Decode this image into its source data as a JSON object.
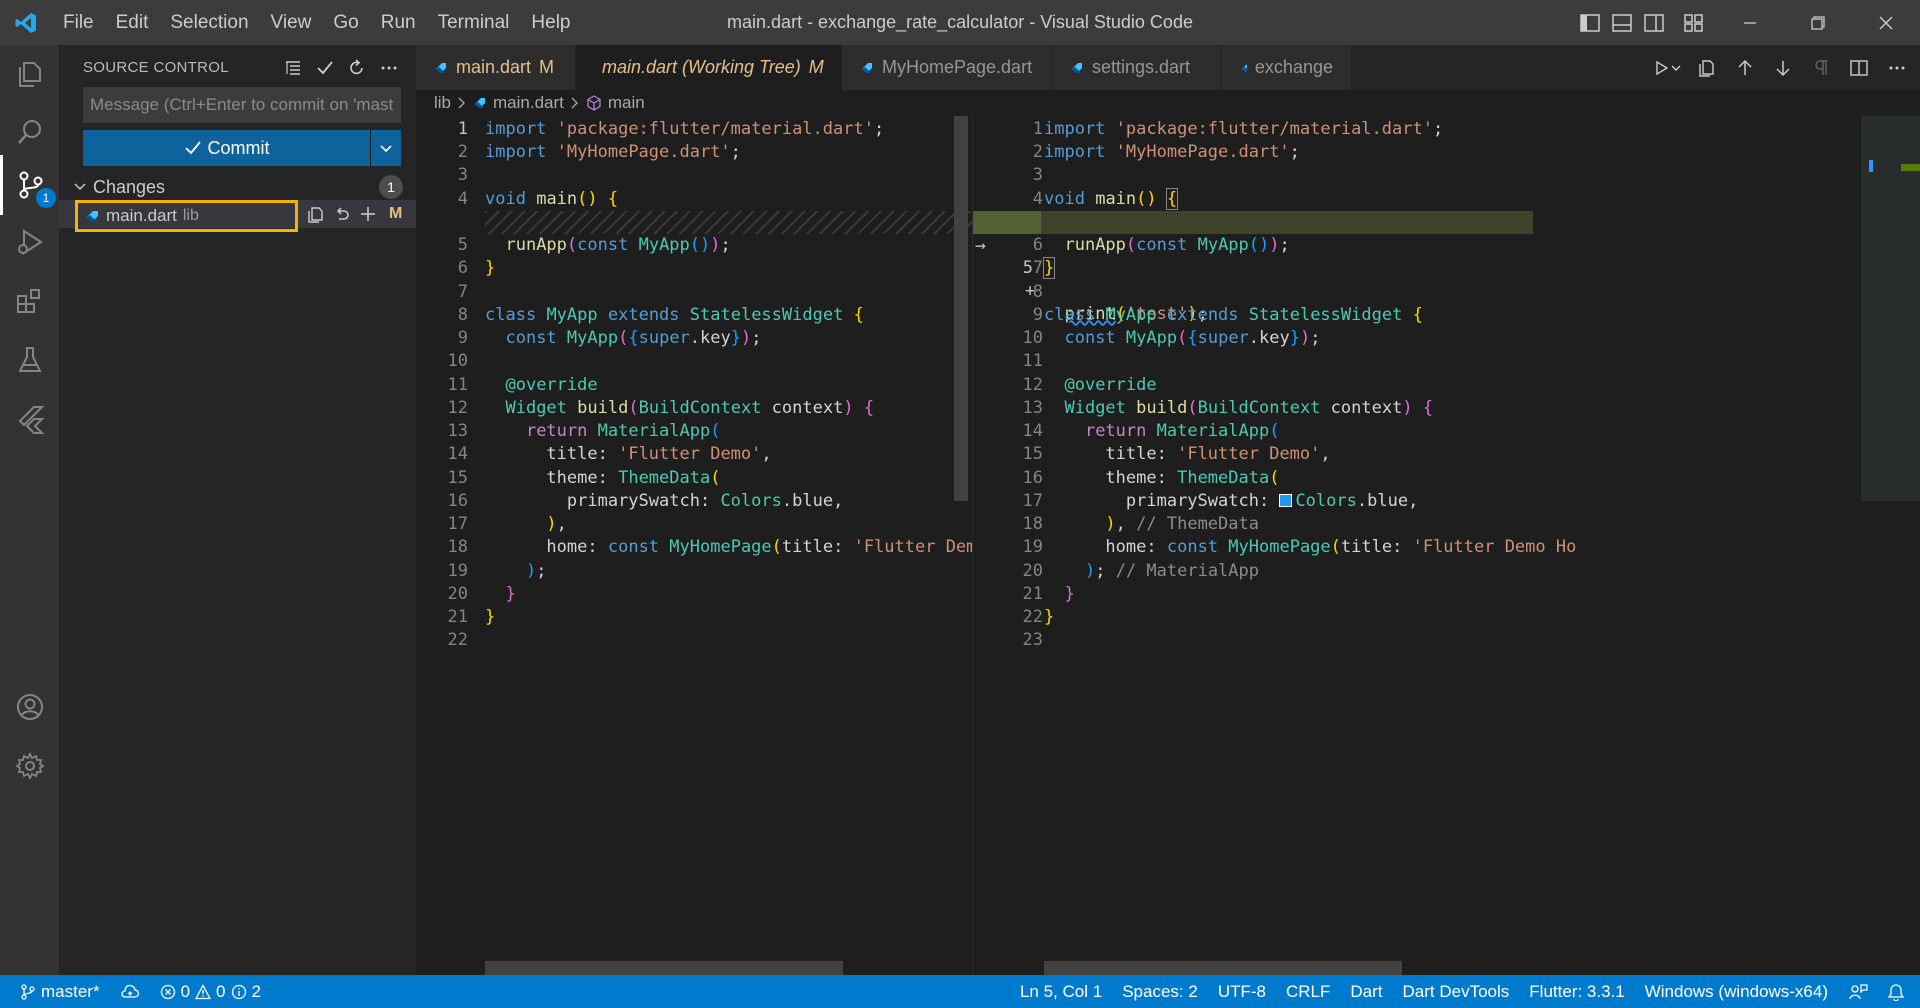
{
  "window": {
    "title": "main.dart - exchange_rate_calculator - Visual Studio Code"
  },
  "menu": [
    "File",
    "Edit",
    "Selection",
    "View",
    "Go",
    "Run",
    "Terminal",
    "Help"
  ],
  "activity": {
    "source_control_badge": "1"
  },
  "sidebar": {
    "title": "SOURCE CONTROL",
    "message_placeholder": "Message (Ctrl+Enter to commit on 'master')",
    "commit_label": "Commit",
    "changes_label": "Changes",
    "changes_count": "1",
    "file": {
      "name": "main.dart",
      "dir": "lib",
      "status": "M"
    }
  },
  "tabs": [
    {
      "label": "main.dart",
      "status": "M"
    },
    {
      "label": "main.dart (Working Tree)",
      "status": "M"
    },
    {
      "label": "MyHomePage.dart"
    },
    {
      "label": "settings.dart"
    },
    {
      "label": "exchange"
    }
  ],
  "breadcrumb": [
    "lib",
    "main.dart",
    "main"
  ],
  "left_editor": {
    "line_numbers": [
      "1",
      "2",
      "3",
      "4",
      "5",
      "6",
      "7",
      "8",
      "9",
      "10",
      "11",
      "12",
      "13",
      "14",
      "15",
      "16",
      "17",
      "18",
      "19",
      "20",
      "21",
      "22"
    ]
  },
  "right_editor": {
    "line_numbers": [
      "1",
      "2",
      "3",
      "4",
      "5",
      "6",
      "7",
      "8",
      "9",
      "10",
      "11",
      "12",
      "13",
      "14",
      "15",
      "16",
      "17",
      "18",
      "19",
      "20",
      "21",
      "22",
      "23"
    ]
  },
  "code": {
    "import1_kw": "import",
    "import1_str": "'package:flutter/material.dart'",
    "import2_str": "'MyHomePage.dart'",
    "semi": ";",
    "void": "void",
    "main": "main",
    "print": "print",
    "print_arg": "'test'",
    "runApp": "runApp",
    "const": "const",
    "MyApp": "MyApp",
    "class": "class",
    "extends": "extends",
    "StatelessWidget": "StatelessWidget",
    "super": "super",
    "key": "key",
    "override": "@override",
    "Widget": "Widget",
    "build": "build",
    "BuildContext": "BuildContext",
    "context": "context",
    "return": "return",
    "MaterialApp": "MaterialApp",
    "title": "title",
    "title_str": "'Flutter Demo'",
    "theme": "theme",
    "ThemeData": "ThemeData",
    "primarySwatch": "primarySwatch",
    "Colors": "Colors",
    "blue": "blue",
    "home": "home",
    "MyHomePage": "MyHomePage",
    "home_title_str": "'Flutter Demo Ho",
    "cm_themedata": "// ThemeData",
    "cm_materialapp": "// MaterialApp"
  },
  "status": {
    "branch": "master*",
    "errors": "0",
    "warnings": "0",
    "info": "2",
    "position": "Ln 5, Col 1",
    "spaces": "Spaces: 2",
    "encoding": "UTF-8",
    "eol": "CRLF",
    "language": "Dart",
    "devtools": "Dart DevTools",
    "flutter": "Flutter: 3.3.1",
    "platform": "Windows (windows-x64)"
  },
  "colors": {
    "accent": "#007acc",
    "highlight_border": "#f5b400",
    "modified": "#e2c08d"
  }
}
